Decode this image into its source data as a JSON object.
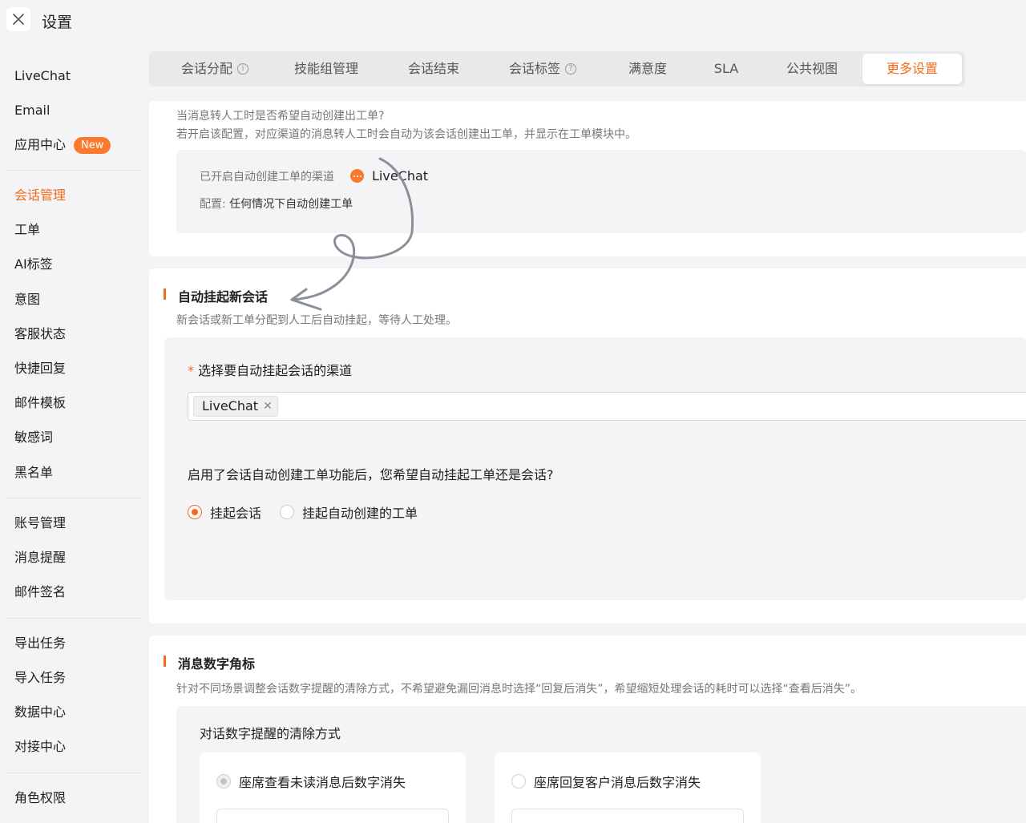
{
  "header": {
    "title": "设置",
    "close_icon": "close-icon"
  },
  "sidebar": {
    "groups": [
      [
        {
          "label": "LiveChat"
        },
        {
          "label": "Email"
        },
        {
          "label": "应用中心",
          "badge": "New"
        }
      ],
      [
        {
          "label": "会话管理",
          "active": true
        },
        {
          "label": "工单"
        },
        {
          "label": "AI标签"
        },
        {
          "label": "意图"
        },
        {
          "label": "客服状态"
        },
        {
          "label": "快捷回复"
        },
        {
          "label": "邮件模板"
        },
        {
          "label": "敏感词"
        },
        {
          "label": "黑名单"
        }
      ],
      [
        {
          "label": "账号管理"
        },
        {
          "label": "消息提醒"
        },
        {
          "label": "邮件签名"
        }
      ],
      [
        {
          "label": "导出任务"
        },
        {
          "label": "导入任务"
        },
        {
          "label": "数据中心"
        },
        {
          "label": "对接中心"
        }
      ],
      [
        {
          "label": "角色权限"
        }
      ]
    ]
  },
  "tabs": [
    {
      "label": "会话分配",
      "icon": "info-icon"
    },
    {
      "label": "技能组管理"
    },
    {
      "label": "会话结束"
    },
    {
      "label": "会话标签",
      "icon": "help-icon"
    },
    {
      "label": "满意度"
    },
    {
      "label": "SLA"
    },
    {
      "label": "公共视图"
    },
    {
      "label": "更多设置",
      "active": true
    }
  ],
  "auto_ticket": {
    "question": "当消息转人工时是否希望自动创建出工单?",
    "description": "若开启该配置，对应渠道的消息转人工时会自动为该会话创建出工单，并显示在工单模块中。",
    "enabled_channels_label": "已开启自动创建工单的渠道",
    "channel_name": "LiveChat",
    "config_label": "配置:",
    "config_value": "任何情况下自动创建工单"
  },
  "auto_suspend": {
    "title": "自动挂起新会话",
    "description": "新会话或新工单分配到人工后自动挂起，等待人工处理。",
    "required_mark": "*",
    "channel_field_label": "选择要自动挂起会话的渠道",
    "selected_tags": [
      "LiveChat"
    ],
    "question": "启用了会话自动创建工单功能后，您希望自动挂起工单还是会话?",
    "options": [
      {
        "label": "挂起会话",
        "checked": true
      },
      {
        "label": "挂起自动创建的工单",
        "checked": false
      }
    ]
  },
  "badge_section": {
    "title": "消息数字角标",
    "description": "针对不同场景调整会话数字提醒的清除方式，不希望避免漏回消息时选择“回复后消失”，希望缩短处理会话的耗时可以选择“查看后消失”。",
    "field_label": "对话数字提醒的清除方式",
    "options": [
      {
        "label": "座席查看未读消息后数字消失",
        "checked": true
      },
      {
        "label": "座席回复客户消息后数字消失",
        "checked": false
      }
    ]
  },
  "colors": {
    "accent": "#f26b1d",
    "badge": "#f97a2c",
    "background": "#f4f4f6"
  }
}
